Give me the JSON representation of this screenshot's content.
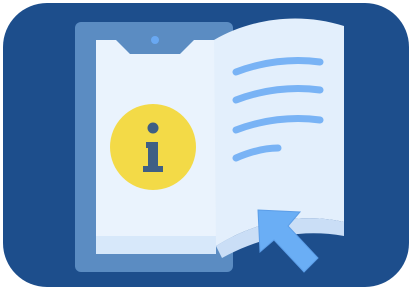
{
  "illustration": {
    "icon": "info-manual-icon",
    "info_glyph": "i",
    "colors": {
      "background": "#1D4E8C",
      "phone_frame": "#5B8CC2",
      "phone_screen": "#EAF3FD",
      "phone_screen_bottom": "#D7E8FA",
      "notch_dot": "#69A8F2",
      "page": "#E3EFFC",
      "page_fold": "#CADEF6",
      "text_lines": "#79B3F5",
      "info_circle": "#F3DA47",
      "info_glyph": "#3F5F84",
      "cursor": "#6AAEF5"
    }
  }
}
